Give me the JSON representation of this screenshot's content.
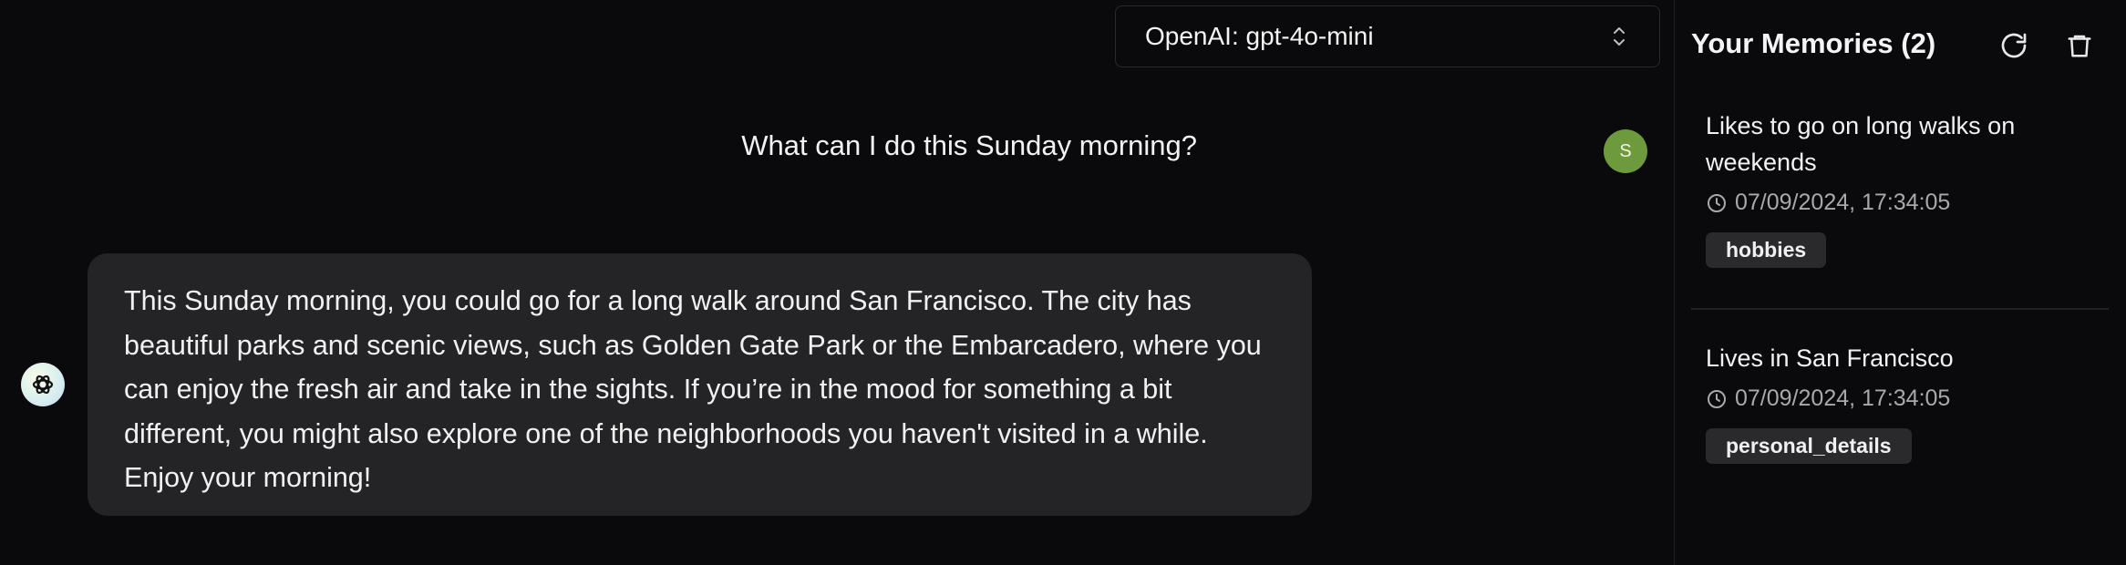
{
  "model_select": {
    "value": "OpenAI: gpt-4o-mini",
    "icon": "chevron-up-down-icon"
  },
  "messages": {
    "user": {
      "text": "What can I do this Sunday morning?",
      "avatar_letter": "S",
      "avatar_color": "#6d9a3d"
    },
    "assistant": {
      "text": "This Sunday morning, you could go for a long walk around San Francisco. The city has beautiful parks and scenic views, such as Golden Gate Park or the Embarcadero, where you can enjoy the fresh air and take in the sights. If you’re in the mood for something a bit different, you might also explore one of the neighborhoods you haven't visited in a while. Enjoy your morning!"
    }
  },
  "sidebar": {
    "title": "Your Memories (2)",
    "refresh_icon": "refresh-icon",
    "delete_icon": "trash-icon",
    "memories": [
      {
        "content": "Likes to go on long walks on weekends",
        "timestamp": "07/09/2024, 17:34:05",
        "tag": "hobbies"
      },
      {
        "content": "Lives in San Francisco",
        "timestamp": "07/09/2024, 17:34:05",
        "tag": "personal_details"
      }
    ]
  },
  "colors": {
    "background": "#0a0a0c",
    "bubble": "#242426",
    "tag_bg": "#2a2a2d",
    "muted_text": "#a8a8ad"
  }
}
